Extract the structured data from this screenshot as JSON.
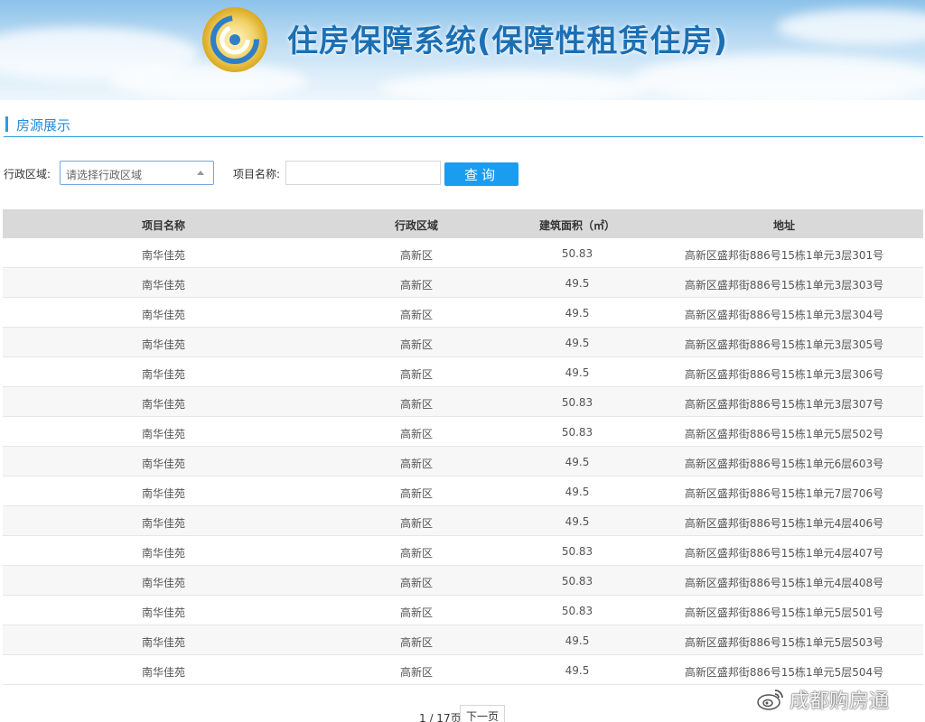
{
  "banner": {
    "title": "住房保障系统(保障性租赁住房)",
    "logo_icon": "sun-swirl-logo-icon"
  },
  "section": {
    "title": "房源展示"
  },
  "filters": {
    "district_label": "行政区域:",
    "district_placeholder": "请选择行政区域",
    "project_label": "项目名称:",
    "project_value": "",
    "query_label": "查询"
  },
  "table": {
    "headers": [
      "项目名称",
      "行政区域",
      "建筑面积（㎡）",
      "地址"
    ],
    "rows": [
      {
        "name": "南华佳苑",
        "district": "高新区",
        "area": "50.83",
        "address": "高新区盛邦街886号15栋1单元3层301号"
      },
      {
        "name": "南华佳苑",
        "district": "高新区",
        "area": "49.5",
        "address": "高新区盛邦街886号15栋1单元3层303号"
      },
      {
        "name": "南华佳苑",
        "district": "高新区",
        "area": "49.5",
        "address": "高新区盛邦街886号15栋1单元3层304号"
      },
      {
        "name": "南华佳苑",
        "district": "高新区",
        "area": "49.5",
        "address": "高新区盛邦街886号15栋1单元3层305号"
      },
      {
        "name": "南华佳苑",
        "district": "高新区",
        "area": "49.5",
        "address": "高新区盛邦街886号15栋1单元3层306号"
      },
      {
        "name": "南华佳苑",
        "district": "高新区",
        "area": "50.83",
        "address": "高新区盛邦街886号15栋1单元3层307号"
      },
      {
        "name": "南华佳苑",
        "district": "高新区",
        "area": "50.83",
        "address": "高新区盛邦街886号15栋1单元5层502号"
      },
      {
        "name": "南华佳苑",
        "district": "高新区",
        "area": "49.5",
        "address": "高新区盛邦街886号15栋1单元6层603号"
      },
      {
        "name": "南华佳苑",
        "district": "高新区",
        "area": "49.5",
        "address": "高新区盛邦街886号15栋1单元7层706号"
      },
      {
        "name": "南华佳苑",
        "district": "高新区",
        "area": "49.5",
        "address": "高新区盛邦街886号15栋1单元4层406号"
      },
      {
        "name": "南华佳苑",
        "district": "高新区",
        "area": "50.83",
        "address": "高新区盛邦街886号15栋1单元4层407号"
      },
      {
        "name": "南华佳苑",
        "district": "高新区",
        "area": "50.83",
        "address": "高新区盛邦街886号15栋1单元4层408号"
      },
      {
        "name": "南华佳苑",
        "district": "高新区",
        "area": "50.83",
        "address": "高新区盛邦街886号15栋1单元5层501号"
      },
      {
        "name": "南华佳苑",
        "district": "高新区",
        "area": "49.5",
        "address": "高新区盛邦街886号15栋1单元5层503号"
      },
      {
        "name": "南华佳苑",
        "district": "高新区",
        "area": "49.5",
        "address": "高新区盛邦街886号15栋1单元5层504号"
      }
    ]
  },
  "pagination": {
    "info": "1 / 17页",
    "next_label": "下一页"
  },
  "watermark": {
    "text": "成都购房通",
    "icon": "weibo-icon"
  },
  "colors": {
    "accent": "#2a9be0",
    "button": "#1a9cf0",
    "banner_title": "#1c6fb3",
    "header_bg": "#d9d9d9"
  }
}
